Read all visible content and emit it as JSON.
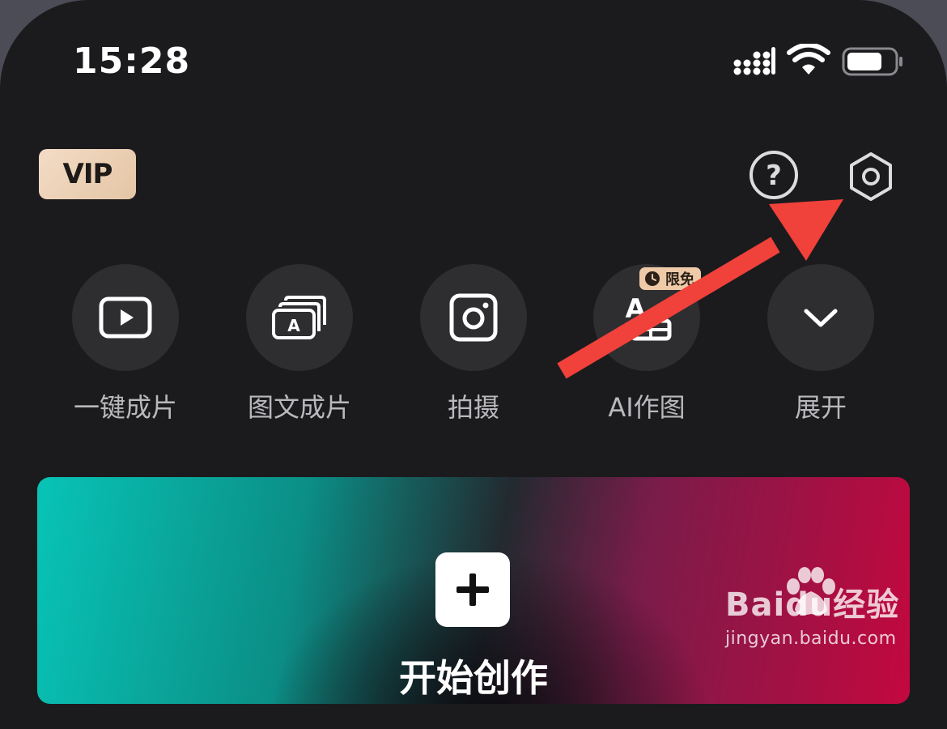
{
  "status_bar": {
    "time": "15:28"
  },
  "header": {
    "vip_label": "VIP"
  },
  "actions": [
    {
      "label": "一键成片",
      "icon": "play-icon"
    },
    {
      "label": "图文成片",
      "icon": "text-to-video-icon"
    },
    {
      "label": "拍摄",
      "icon": "camera-icon"
    },
    {
      "label": "AI作图",
      "icon": "ai-image-icon",
      "badge": "限免"
    },
    {
      "label": "展开",
      "icon": "chevron-down-icon"
    }
  ],
  "create": {
    "title": "开始创作"
  },
  "watermark": {
    "brand": "Baidu经验",
    "url": "jingyan.baidu.com"
  },
  "colors": {
    "accent_arrow": "#f0413a",
    "vip_gold": "#efd3b8",
    "background": "#1b1b1d"
  }
}
